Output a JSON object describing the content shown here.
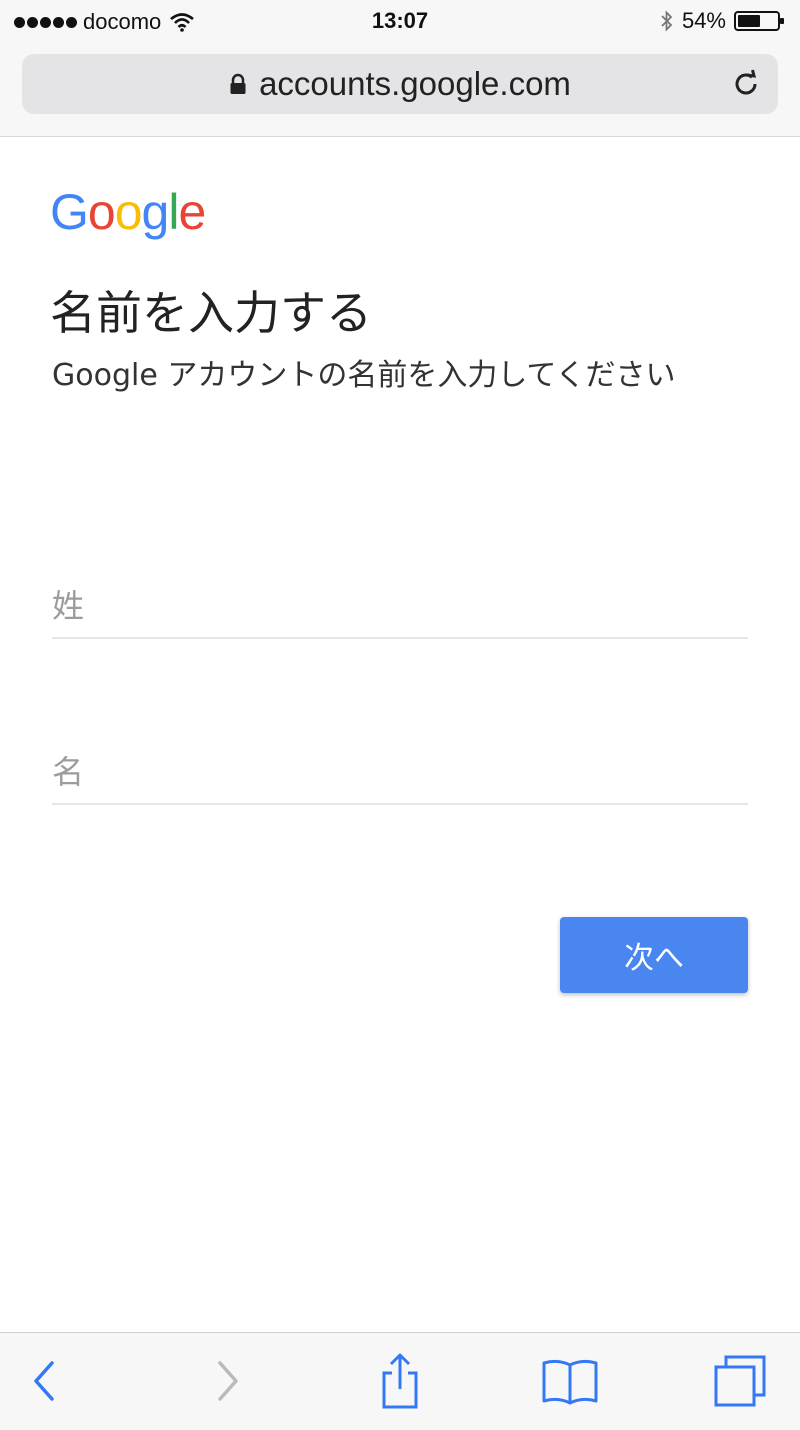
{
  "status_bar": {
    "carrier": "docomo",
    "time": "13:07",
    "battery": "54%",
    "icons": [
      "signal-icon",
      "wifi-icon",
      "bluetooth-icon",
      "battery-icon"
    ]
  },
  "browser": {
    "url": "accounts.google.com",
    "icons": [
      "lock-icon",
      "reload-icon"
    ]
  },
  "page": {
    "logo": [
      "G",
      "o",
      "o",
      "g",
      "l",
      "e"
    ],
    "logo_colors": [
      "#4285F4",
      "#EA4335",
      "#FBBC05",
      "#4285F4",
      "#34A853",
      "#EA4335"
    ],
    "heading": "名前を入力する",
    "subtitle": "Google アカウントの名前を入力してください",
    "last_name_placeholder": "姓",
    "first_name_placeholder": "名",
    "next_button": "次へ",
    "accent_color": "#4A86F0"
  },
  "toolbar": {
    "icons": [
      "back-icon",
      "forward-icon",
      "share-icon",
      "bookmarks-icon",
      "tabs-icon"
    ],
    "tint": "#3478F6",
    "disabled_tint": "#B9B9BE"
  }
}
